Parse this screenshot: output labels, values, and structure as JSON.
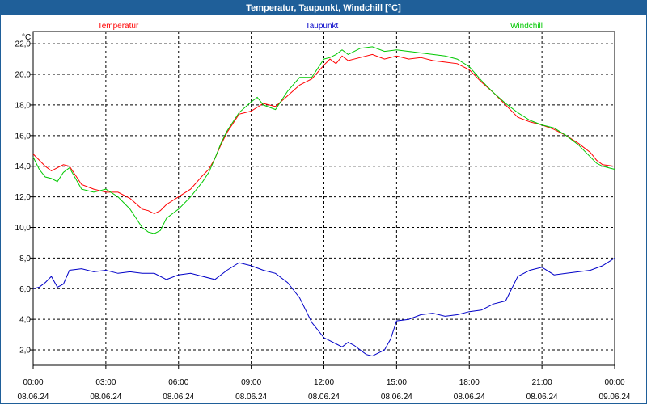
{
  "window": {
    "title": "Temperatur, Taupunkt, Windchill [°C]"
  },
  "chart_data": {
    "type": "line",
    "title": "Temperatur, Taupunkt, Windchill [°C]",
    "ylabel": "°C",
    "ylim": [
      1.0,
      22.8
    ],
    "y_ticks": [
      "2,0",
      "4,0",
      "6,0",
      "8,0",
      "10,0",
      "12,0",
      "14,0",
      "16,0",
      "18,0",
      "20,0",
      "22,0"
    ],
    "y_tick_values": [
      2,
      4,
      6,
      8,
      10,
      12,
      14,
      16,
      18,
      20,
      22
    ],
    "xlim": [
      0,
      24
    ],
    "x_ticks": [
      {
        "x": 0,
        "time": "00:00",
        "date": "08.06.24"
      },
      {
        "x": 3,
        "time": "03:00",
        "date": "08.06.24"
      },
      {
        "x": 6,
        "time": "06:00",
        "date": "08.06.24"
      },
      {
        "x": 9,
        "time": "09:00",
        "date": "08.06.24"
      },
      {
        "x": 12,
        "time": "12:00",
        "date": "08.06.24"
      },
      {
        "x": 15,
        "time": "15:00",
        "date": "08.06.24"
      },
      {
        "x": 18,
        "time": "18:00",
        "date": "08.06.24"
      },
      {
        "x": 21,
        "time": "21:00",
        "date": "08.06.24"
      },
      {
        "x": 24,
        "time": "00:00",
        "date": "09.06.24"
      }
    ],
    "grid": true,
    "legend": "top",
    "series": [
      {
        "name": "Temperatur",
        "color": "#ff0000",
        "x": [
          0,
          0.5,
          0.75,
          1.0,
          1.25,
          1.5,
          2,
          2.5,
          3,
          3.5,
          4,
          4.5,
          4.75,
          5,
          5.25,
          5.5,
          6,
          6.5,
          7,
          7.25,
          7.5,
          7.75,
          8,
          8.5,
          9,
          9.5,
          10,
          10.5,
          11,
          11.5,
          12,
          12.25,
          12.5,
          12.75,
          13,
          13.5,
          14,
          14.5,
          15,
          15.5,
          16,
          16.5,
          17,
          17.5,
          18,
          18.5,
          19,
          19.5,
          20,
          20.5,
          21,
          21.5,
          22,
          22.5,
          23,
          23.25,
          23.5,
          24
        ],
        "y": [
          14.8,
          14.0,
          13.7,
          13.9,
          14.1,
          14.0,
          12.8,
          12.5,
          12.3,
          12.3,
          11.9,
          11.2,
          11.1,
          10.9,
          11.1,
          11.5,
          12.0,
          12.5,
          13.4,
          13.8,
          14.5,
          15.4,
          16.2,
          17.4,
          17.6,
          18.1,
          17.9,
          18.6,
          19.3,
          19.7,
          20.6,
          21.0,
          20.7,
          21.2,
          20.9,
          21.1,
          21.3,
          21.0,
          21.2,
          21.0,
          21.1,
          20.9,
          20.8,
          20.7,
          20.3,
          19.5,
          18.8,
          18.0,
          17.2,
          16.9,
          16.7,
          16.4,
          16.0,
          15.5,
          14.9,
          14.4,
          14.1,
          14.0
        ]
      },
      {
        "name": "Taupunkt",
        "color": "#0000c8",
        "x": [
          0,
          0.25,
          0.5,
          0.75,
          1.0,
          1.25,
          1.5,
          2,
          2.5,
          3,
          3.5,
          4,
          4.5,
          5,
          5.5,
          6,
          6.5,
          7,
          7.5,
          8,
          8.5,
          9,
          9.5,
          10,
          10.5,
          11,
          11.25,
          11.5,
          11.75,
          12,
          12.25,
          12.5,
          12.75,
          13,
          13.25,
          13.5,
          13.75,
          14,
          14.25,
          14.5,
          14.75,
          15,
          15.5,
          16,
          16.5,
          17,
          17.5,
          18,
          18.5,
          19,
          19.5,
          20,
          20.5,
          21,
          21.5,
          22,
          22.5,
          23,
          23.5,
          24
        ],
        "y": [
          6.0,
          6.1,
          6.4,
          6.8,
          6.1,
          6.3,
          7.2,
          7.3,
          7.1,
          7.2,
          7.0,
          7.1,
          7.0,
          7.0,
          6.6,
          6.9,
          7.0,
          6.8,
          6.6,
          7.2,
          7.7,
          7.5,
          7.2,
          7.0,
          6.4,
          5.4,
          4.6,
          3.8,
          3.3,
          2.8,
          2.6,
          2.4,
          2.2,
          2.5,
          2.3,
          2.0,
          1.7,
          1.6,
          1.8,
          2.0,
          2.7,
          3.9,
          4.0,
          4.3,
          4.4,
          4.2,
          4.3,
          4.5,
          4.6,
          5.0,
          5.2,
          6.8,
          7.2,
          7.4,
          6.9,
          7.0,
          7.1,
          7.2,
          7.5,
          8.0
        ]
      },
      {
        "name": "Windchill",
        "color": "#00c800",
        "x": [
          0,
          0.25,
          0.5,
          0.75,
          1.0,
          1.25,
          1.5,
          2,
          2.5,
          3,
          3.5,
          4,
          4.25,
          4.5,
          4.75,
          5,
          5.25,
          5.5,
          6,
          6.5,
          7,
          7.25,
          7.5,
          7.75,
          8,
          8.5,
          9,
          9.25,
          9.5,
          10,
          10.5,
          11,
          11.5,
          12,
          12.25,
          12.5,
          12.75,
          13,
          13.5,
          14,
          14.5,
          15,
          15.5,
          16,
          16.5,
          17,
          17.5,
          18,
          18.5,
          19,
          19.5,
          20,
          20.5,
          21,
          21.5,
          22,
          22.5,
          23,
          23.25,
          23.5,
          23.75,
          24
        ],
        "y": [
          14.6,
          13.8,
          13.3,
          13.2,
          13.0,
          13.6,
          13.9,
          12.5,
          12.3,
          12.5,
          12.0,
          11.2,
          10.6,
          10.0,
          9.7,
          9.6,
          9.8,
          10.6,
          11.2,
          12.0,
          13.0,
          13.6,
          14.5,
          15.5,
          16.3,
          17.5,
          18.2,
          18.5,
          18.0,
          17.7,
          18.9,
          19.8,
          19.8,
          21.0,
          21.1,
          21.3,
          21.6,
          21.3,
          21.7,
          21.8,
          21.5,
          21.6,
          21.5,
          21.4,
          21.3,
          21.2,
          21.0,
          20.5,
          19.6,
          18.8,
          18.1,
          17.5,
          17.0,
          16.7,
          16.5,
          16.0,
          15.4,
          14.6,
          14.2,
          14.0,
          13.9,
          13.8
        ]
      }
    ]
  }
}
